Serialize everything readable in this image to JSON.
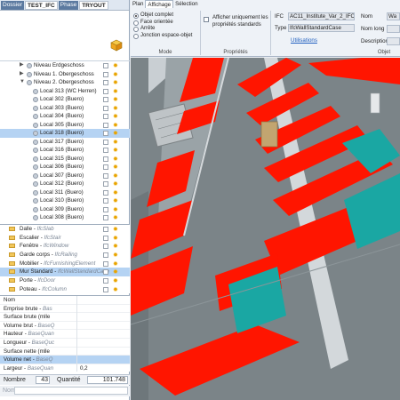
{
  "topbar": {
    "dossier_label": "Dossier",
    "dossier_value": "TEST_IFC",
    "phase_label": "Phase",
    "phase_value": "TRYOUT",
    "test_badge": "TEST"
  },
  "tree": [
    {
      "label": "Niveau Erdgeschoss",
      "depth": 1,
      "expander": "▶",
      "icon": "level"
    },
    {
      "label": "Niveau 1. Obergeschoss",
      "depth": 1,
      "expander": "▶",
      "icon": "level"
    },
    {
      "label": "Niveau 2. Obergeschoss",
      "depth": 1,
      "expander": "▼",
      "icon": "level"
    },
    {
      "label": "Local 313 (WC Herren)",
      "depth": 2,
      "expander": "",
      "icon": "space"
    },
    {
      "label": "Local 302 (Buero)",
      "depth": 2,
      "expander": "",
      "icon": "space"
    },
    {
      "label": "Local 303 (Buero)",
      "depth": 2,
      "expander": "",
      "icon": "space"
    },
    {
      "label": "Local 304 (Buero)",
      "depth": 2,
      "expander": "",
      "icon": "space"
    },
    {
      "label": "Local 305 (Buero)",
      "depth": 2,
      "expander": "",
      "icon": "space"
    },
    {
      "label": "Local 318 (Buero)",
      "depth": 2,
      "expander": "",
      "icon": "space",
      "selected": true
    },
    {
      "label": "Local 317 (Buero)",
      "depth": 2,
      "expander": "",
      "icon": "space"
    },
    {
      "label": "Local 316 (Buero)",
      "depth": 2,
      "expander": "",
      "icon": "space"
    },
    {
      "label": "Local 315 (Buero)",
      "depth": 2,
      "expander": "",
      "icon": "space"
    },
    {
      "label": "Local 306 (Buero)",
      "depth": 2,
      "expander": "",
      "icon": "space"
    },
    {
      "label": "Local 307 (Buero)",
      "depth": 2,
      "expander": "",
      "icon": "space"
    },
    {
      "label": "Local 312 (Buero)",
      "depth": 2,
      "expander": "",
      "icon": "space"
    },
    {
      "label": "Local 311 (Buero)",
      "depth": 2,
      "expander": "",
      "icon": "space"
    },
    {
      "label": "Local 310 (Buero)",
      "depth": 2,
      "expander": "",
      "icon": "space"
    },
    {
      "label": "Local 309 (Buero)",
      "depth": 2,
      "expander": "",
      "icon": "space"
    },
    {
      "label": "Local 308 (Buero)",
      "depth": 2,
      "expander": "",
      "icon": "space"
    }
  ],
  "types": [
    {
      "name": "Dalle",
      "ifc": "IfcSlab"
    },
    {
      "name": "Escalier",
      "ifc": "IfcStair"
    },
    {
      "name": "Fenêtre",
      "ifc": "IfcWindow"
    },
    {
      "name": "Garde corps",
      "ifc": "IfcRailing"
    },
    {
      "name": "Mobilier",
      "ifc": "IfcFurnishingElement"
    },
    {
      "name": "Mur Standard",
      "ifc": "IfcWallStandardCase",
      "selected": true
    },
    {
      "name": "Porte",
      "ifc": "IfcDoor"
    },
    {
      "name": "Poteau",
      "ifc": "IfcColumn"
    }
  ],
  "properties": [
    {
      "name": "Nom",
      "ifc": "",
      "value": ""
    },
    {
      "name": "Emprise brute",
      "ifc": "Bas",
      "value": ""
    },
    {
      "name": "Surface brute (mlle",
      "ifc": "",
      "value": ""
    },
    {
      "name": "Volume brut",
      "ifc": "BaseQ",
      "value": ""
    },
    {
      "name": "Hauteur",
      "ifc": "BaseQuan",
      "value": ""
    },
    {
      "name": "Longueur",
      "ifc": "BaseQuc",
      "value": ""
    },
    {
      "name": "Surface nette (mlle",
      "ifc": "",
      "value": ""
    },
    {
      "name": "Volume net",
      "ifc": "BaseQ",
      "value": "",
      "selected": true
    },
    {
      "name": "Largeur",
      "ifc": "BaseQuan",
      "value": "0,2"
    }
  ],
  "count": {
    "nombre_label": "Nombre",
    "nombre_value": "43",
    "quantite_label": "Quantité",
    "quantite_value": "101.748"
  },
  "nom_filter": {
    "label": "Nom",
    "value": ""
  },
  "ribbon": {
    "tabs": [
      "Plan",
      "Affichage",
      "Sélection"
    ],
    "active_tab": 1,
    "mode_options": [
      "Objet complet",
      "Face orientée",
      "Arrête",
      "Jonction espace-objet"
    ],
    "mode_selected": 0,
    "mode_title": "Mode",
    "props_checkbox_label": "Afficher uniquement les propriétés standards",
    "props_title": "Propriétés",
    "ifc_label": "IFC",
    "ifc_value": "AC11_Institute_Var_2_IFC@AC",
    "type_label": "Type",
    "type_value": "IfcWallStandardCase",
    "utilisations_link": "Utilisations",
    "nom_label": "Nom",
    "nom_value": "Wa",
    "nom_long_label": "Nom long",
    "description_label": "Description",
    "objet_title": "Objet"
  },
  "colors": {
    "selection": "#b5d3f3",
    "accent": "#5c7aa0",
    "space_red": "#ff1500",
    "space_teal": "#1aa7a3",
    "floor_grey": "#7b8488"
  }
}
